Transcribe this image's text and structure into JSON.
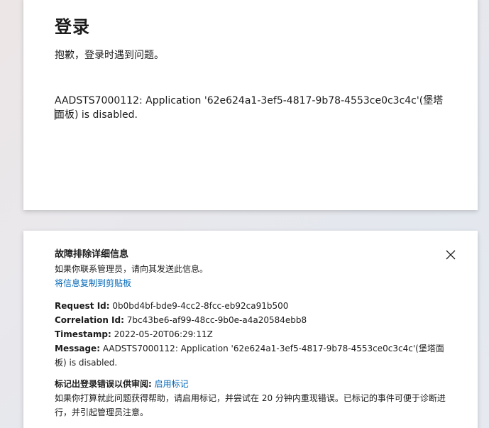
{
  "signin": {
    "title": "登录",
    "subtitle": "抱歉，登录时遇到问题。",
    "error_message": "AADSTS7000112: Application '62e624a1-3ef5-4817-9b78-4553ce0c3c4c'(堡塔面板) is disabled."
  },
  "troubleshooting": {
    "header": "故障排除详细信息",
    "description": "如果你联系管理员，请向其发送此信息。",
    "copy_link": "将信息复制到剪贴板",
    "close_icon": "close-icon",
    "details": [
      {
        "label": "Request Id:",
        "value": " 0b0bd4bf-bde9-4cc2-8fcc-eb92ca91b500"
      },
      {
        "label": "Correlation Id:",
        "value": " 7bc43be6-af99-48cc-9b0e-a4a20584ebb8"
      },
      {
        "label": "Timestamp:",
        "value": " 2022-05-20T06:29:11Z"
      },
      {
        "label": "Message:",
        "value": " AADSTS7000112: Application '62e624a1-3ef5-4817-9b78-4553ce0c3c4c'(堡塔面板) is disabled."
      }
    ],
    "flag": {
      "label": "标记出登录错误以供审阅:",
      "link": "启用标记",
      "description": "如果你打算就此问题获得帮助，请启用标记，并尝试在 20 分钟内重现错误。已标记的事件可便于诊断进行，并引起管理员注意。"
    }
  },
  "colors": {
    "link": "#0067b8",
    "text": "#1b1b1b",
    "card": "#ffffff"
  }
}
